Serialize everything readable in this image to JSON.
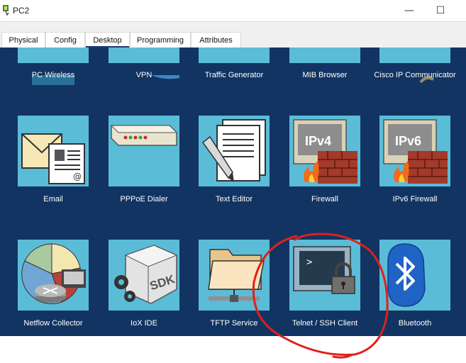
{
  "window": {
    "title": "PC2",
    "minimize_glyph": "—",
    "maximize_glyph": "☐"
  },
  "tabs": [
    {
      "label": "Physical"
    },
    {
      "label": "Config"
    },
    {
      "label": "Desktop",
      "active": true
    },
    {
      "label": "Programming"
    },
    {
      "label": "Attributes"
    }
  ],
  "apps": {
    "row1": [
      {
        "label": "PC Wireless",
        "icon": "pc-wireless-icon"
      },
      {
        "label": "VPN",
        "icon": "vpn-icon"
      },
      {
        "label": "Traffic Generator",
        "icon": "traffic-generator-icon"
      },
      {
        "label": "MIB Browser",
        "icon": "mib-browser-icon"
      },
      {
        "label": "Cisco IP Communicator",
        "icon": "ip-communicator-icon"
      }
    ],
    "row2": [
      {
        "label": "Email",
        "icon": "email-icon"
      },
      {
        "label": "PPPoE Dialer",
        "icon": "pppoe-dialer-icon"
      },
      {
        "label": "Text Editor",
        "icon": "text-editor-icon"
      },
      {
        "label": "Firewall",
        "icon": "firewall-icon",
        "badge": "IPv4"
      },
      {
        "label": "IPv6 Firewall",
        "icon": "ipv6-firewall-icon",
        "badge": "IPv6"
      }
    ],
    "row3": [
      {
        "label": "Netflow Collector",
        "icon": "netflow-collector-icon"
      },
      {
        "label": "IoX IDE",
        "icon": "iox-ide-icon",
        "badge": "SDK"
      },
      {
        "label": "TFTP Service",
        "icon": "tftp-service-icon"
      },
      {
        "label": "Telnet / SSH Client",
        "icon": "telnet-ssh-icon",
        "prompt": ">"
      },
      {
        "label": "Bluetooth",
        "icon": "bluetooth-icon"
      }
    ]
  },
  "colors": {
    "desktop_bg": "#123462",
    "tile_bg": "#5bbcd8",
    "annotation_red": "#e0201a",
    "active_tab_underline": "#1c3b6e"
  }
}
